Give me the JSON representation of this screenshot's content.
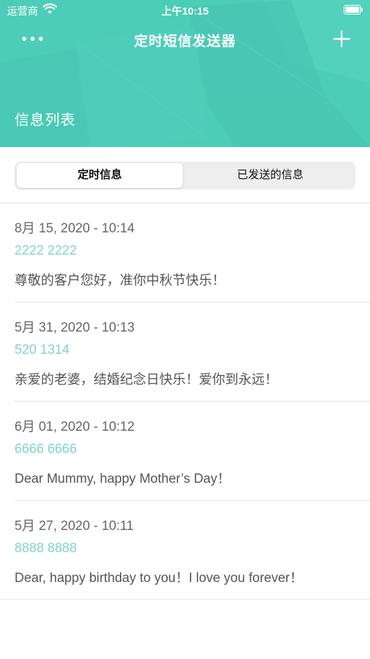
{
  "status_bar": {
    "carrier": "运营商",
    "time": "上午10:15"
  },
  "nav": {
    "title": "定时短信发送器",
    "more_icon": "more-icon",
    "add_icon": "plus-icon"
  },
  "header": {
    "section_title": "信息列表",
    "background_color": "#4ccdb8"
  },
  "tabs": [
    {
      "label": "定时信息",
      "selected": true
    },
    {
      "label": "已发送的信息",
      "selected": false
    }
  ],
  "messages": [
    {
      "date": "8月 15, 2020 - 10:14",
      "phone": "2222 2222",
      "body": "尊敬的客户您好，准你中秋节快乐！"
    },
    {
      "date": "5月 31, 2020 - 10:13",
      "phone": "520 1314",
      "body": "亲爱的老婆，结婚纪念日快乐！爱你到永远！"
    },
    {
      "date": "6月 01, 2020 - 10:12",
      "phone": "6666 6666",
      "body": "Dear Mummy, happy Mother’s Day！"
    },
    {
      "date": "5月 27, 2020 - 10:11",
      "phone": "8888 8888",
      "body": "Dear, happy birthday to you！I love you forever！"
    }
  ],
  "colors": {
    "accent": "#4ccdb8",
    "phone_text": "#7fd4c6"
  }
}
